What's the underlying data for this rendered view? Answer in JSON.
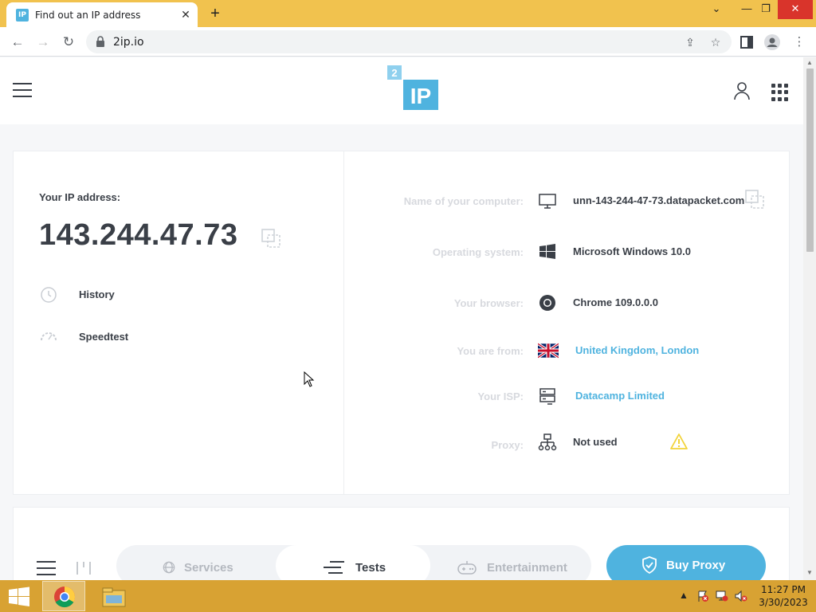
{
  "browser": {
    "tab_title": "Find out an IP address",
    "tab_favicon_text": "IP",
    "url": "2ip.io"
  },
  "site": {
    "logo_superscript": "2",
    "logo_text": "IP"
  },
  "ip_panel": {
    "label": "Your IP address:",
    "ip": "143.244.47.73",
    "links": [
      {
        "label": "History",
        "icon": "history-icon"
      },
      {
        "label": "Speedtest",
        "icon": "speedometer-icon"
      }
    ]
  },
  "info": [
    {
      "label": "Name of your computer:",
      "value": "unn-143-244-47-73.datapacket.com",
      "icon": "monitor-icon",
      "link": false
    },
    {
      "label": "Operating system:",
      "value": "Microsoft Windows 10.0",
      "icon": "windows-logo-icon",
      "link": false
    },
    {
      "label": "Your browser:",
      "value": "Chrome 109.0.0.0",
      "icon": "chrome-logo-icon",
      "link": false
    },
    {
      "label": "You are from:",
      "value": "United Kingdom, London",
      "icon": "uk-flag-icon",
      "link": true
    },
    {
      "label": "Your ISP:",
      "value": "Datacamp Limited",
      "icon": "server-icon",
      "link": true
    },
    {
      "label": "Proxy:",
      "value": "Not used",
      "icon": "network-icon",
      "link": false
    }
  ],
  "bottom_nav": {
    "tabs": [
      {
        "label": "Services",
        "icon": "globe-icon",
        "active": false
      },
      {
        "label": "Tests",
        "icon": "tests-icon",
        "active": true
      },
      {
        "label": "Entertainment",
        "icon": "gamepad-icon",
        "active": false
      }
    ],
    "buy_button": "Buy Proxy"
  },
  "taskbar": {
    "time": "11:27 PM",
    "date": "3/30/2023"
  },
  "colors": {
    "accent": "#4fb3df",
    "title_bar": "#f1c24e",
    "taskbar": "#d8a233",
    "text_dark": "#3a3f47",
    "label_muted": "#d7d9de",
    "warning": "#f2d33a"
  }
}
